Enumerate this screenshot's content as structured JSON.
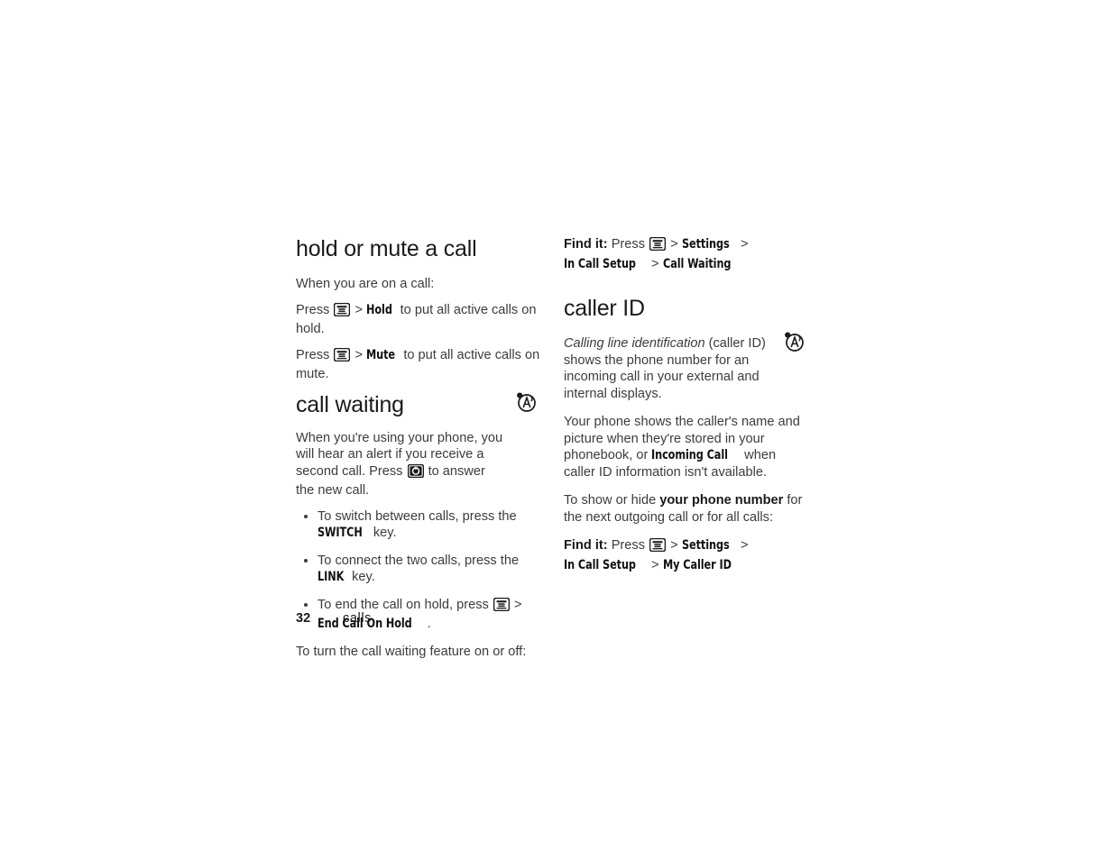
{
  "document": {
    "page_number": "32",
    "section_name": "calls"
  },
  "left_column": {
    "hold_mute": {
      "heading": "hold or mute a call",
      "intro": "When you are on a call:",
      "line1_pre": "Press",
      "line1_sep": ">",
      "line1_menu": "Hold",
      "line1_post": "to put all active calls on hold.",
      "line2_pre": "Press",
      "line2_sep": ">",
      "line2_menu": "Mute",
      "line2_post": "to put all active calls on mute."
    },
    "call_waiting": {
      "heading": "call waiting",
      "intro_part1": "When you're using your phone, you will hear an alert if you receive a second call. Press",
      "intro_part2": "to answer the new call.",
      "bullets": [
        {
          "pre": "To switch between calls, press the",
          "menu": "SWITCH",
          "post": "key."
        },
        {
          "pre": "To connect the two calls, press the",
          "menu": "LINK",
          "post": "key."
        },
        {
          "pre": "To end the call on hold, press",
          "sep": ">",
          "menu": "End Call On Hold",
          "post": "."
        }
      ],
      "closing": "To turn the call waiting feature on or off:"
    }
  },
  "right_column": {
    "findit_call_waiting": {
      "label": "Find it:",
      "press": "Press",
      "sep1": ">",
      "item1": "Settings",
      "sep2": ">",
      "item2": "In Call Setup",
      "sep3": ">",
      "item3": "Call Waiting"
    },
    "caller_id": {
      "heading": "caller ID",
      "para1_italic": "Calling line identification",
      "para1_rest": "(caller ID) shows the phone number for an incoming call in your external and internal displays.",
      "para2_pre": "Your phone shows the caller's name and picture when they're stored in your phonebook, or",
      "para2_menu": "Incoming Call",
      "para2_post": "when caller ID information isn't available.",
      "para3_pre": "To show or hide",
      "para3_bold": "your phone number",
      "para3_post": "for the next outgoing call or for all calls:"
    },
    "findit_my_caller_id": {
      "label": "Find it:",
      "press": "Press",
      "sep1": ">",
      "item1": "Settings",
      "sep2": ">",
      "item2": "In Call Setup",
      "sep3": ">",
      "item3": "My Caller ID"
    }
  },
  "icons": {
    "menu_key": "menu-key-icon",
    "send_key": "send-call-key-icon",
    "network_tip": "network-feature-icon"
  },
  "colors": {
    "heading": "#1a1a1a",
    "body": "#3c3c3c",
    "page_background": "#ffffff"
  }
}
